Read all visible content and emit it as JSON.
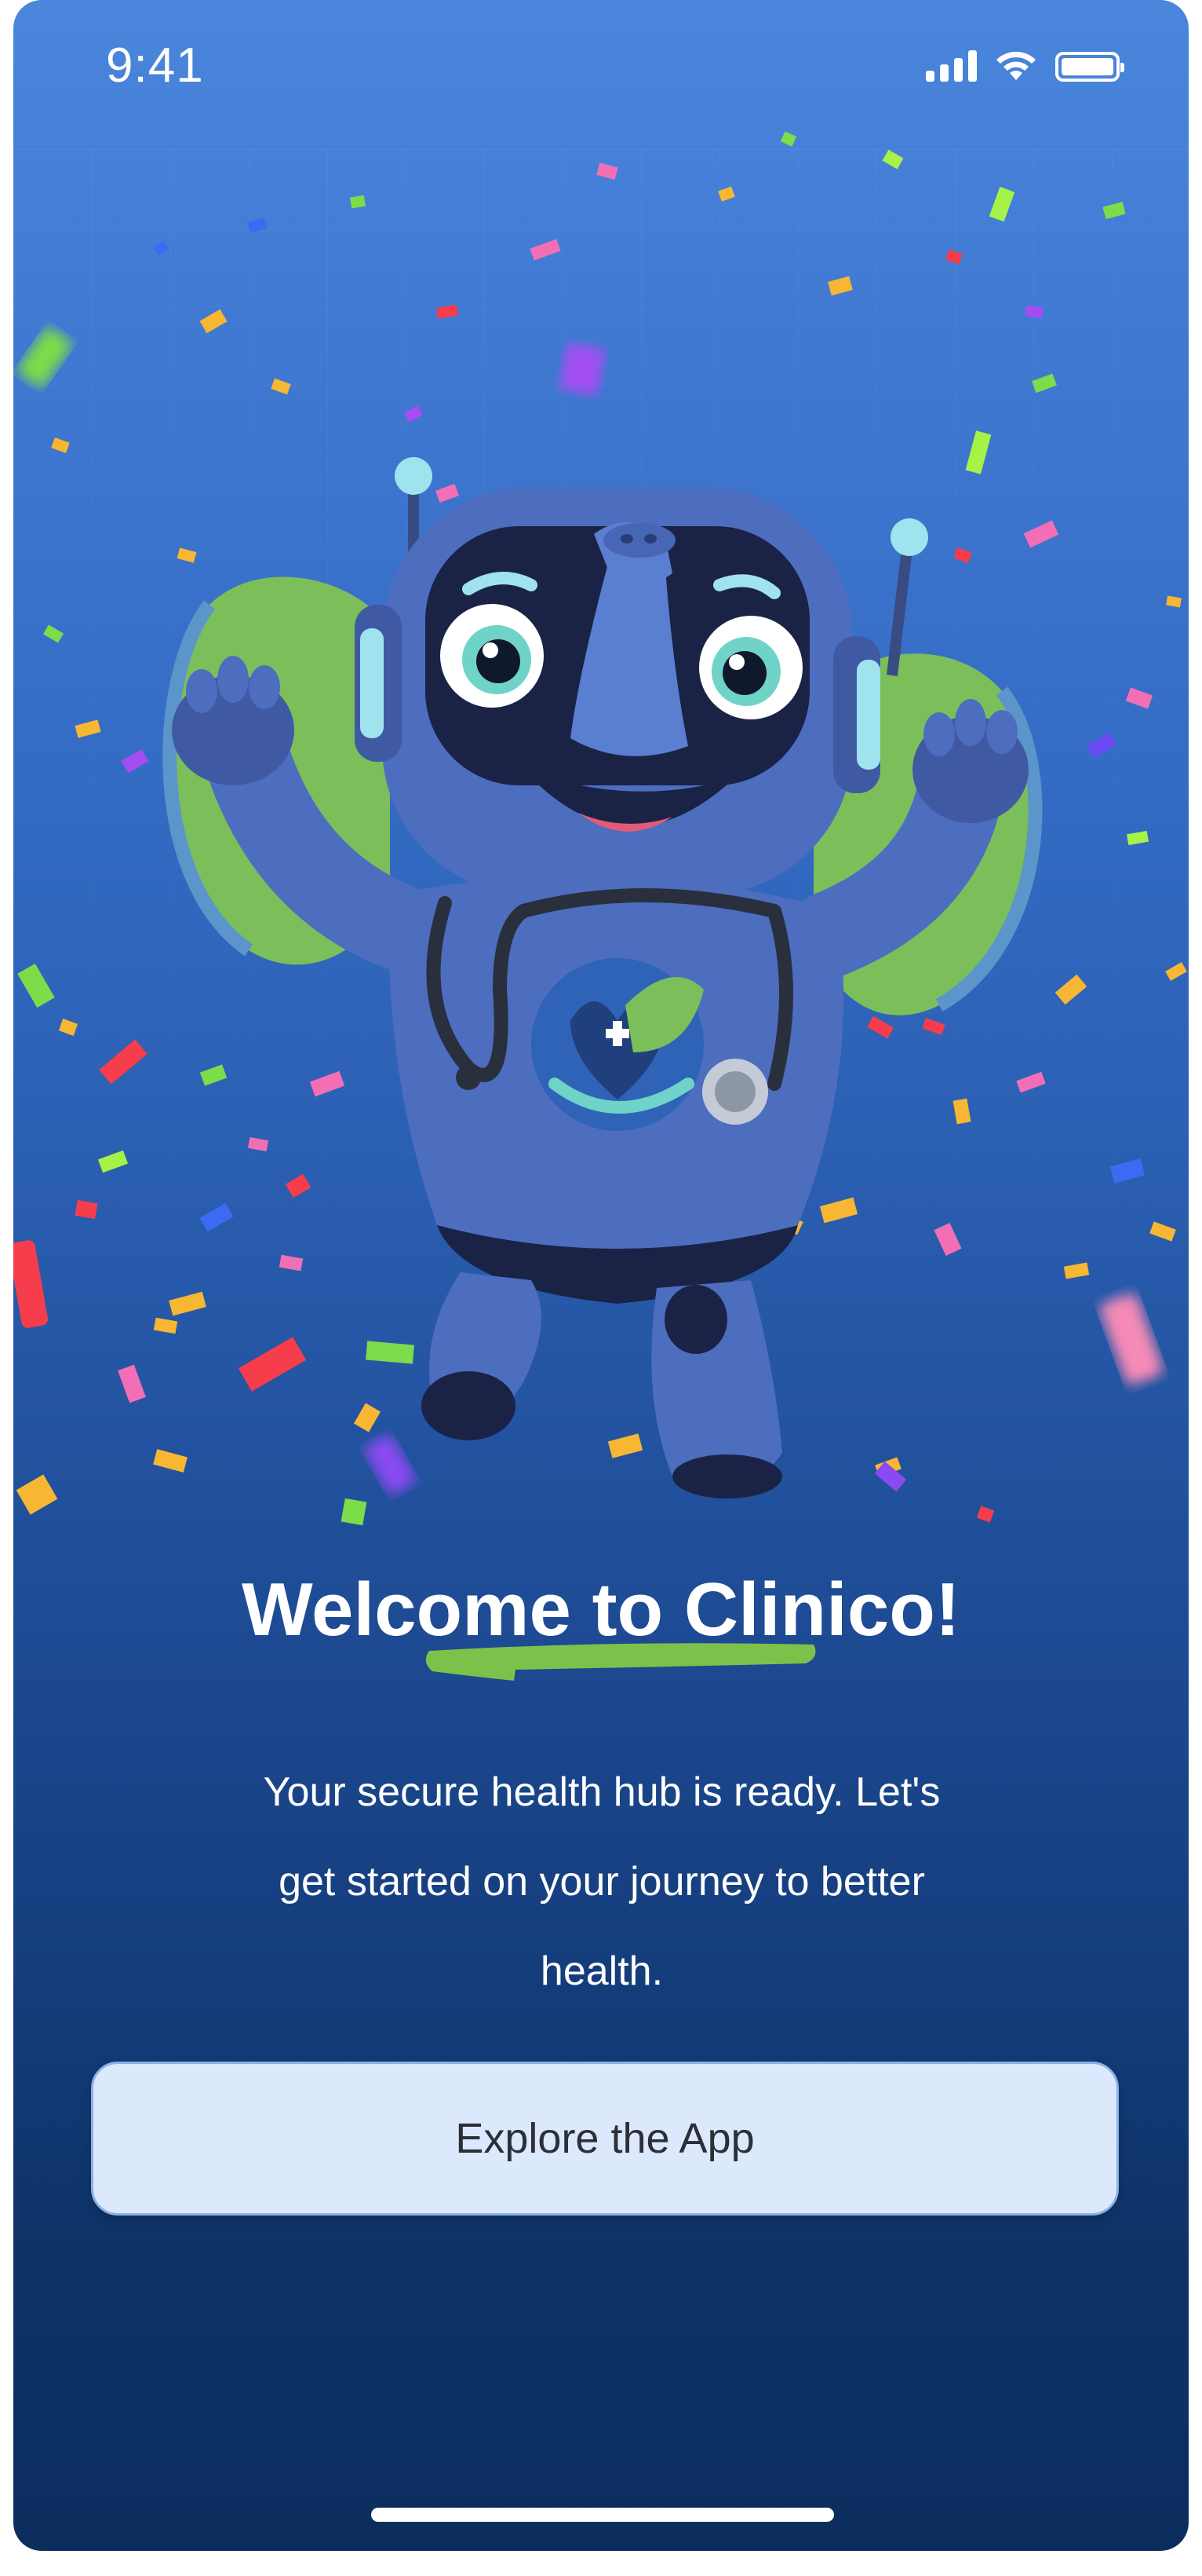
{
  "status_bar": {
    "time": "9:41",
    "icons": [
      "signal-icon",
      "wifi-icon",
      "battery-icon"
    ]
  },
  "hero": {
    "illustration": "robot-elephant-doctor-mascot",
    "decoration": "confetti"
  },
  "welcome": {
    "title": "Welcome to Clinico!",
    "subtitle_line1": "Your secure health hub is ready. Let's",
    "subtitle_line2": "get started on your journey to better",
    "subtitle_line3": "health."
  },
  "actions": {
    "explore_label": "Explore the App"
  },
  "colors": {
    "background_top": "#4a86dc",
    "background_bottom": "#0b2d5e",
    "accent_green": "#7cc24a",
    "button_bg": "#dce8fb",
    "button_text": "#2c2f38"
  }
}
